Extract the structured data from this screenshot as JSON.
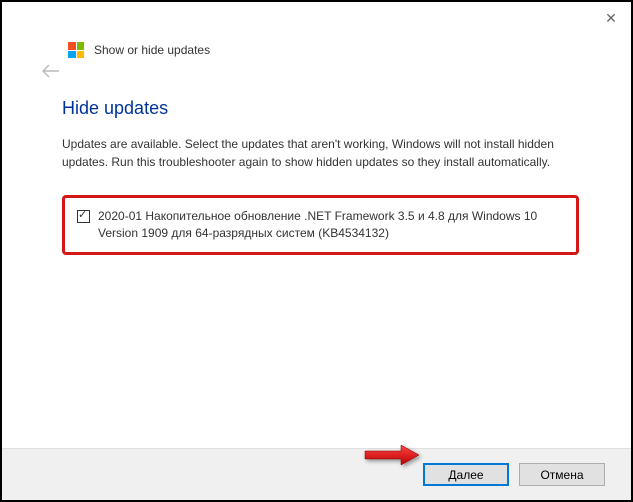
{
  "window": {
    "title": "Show or hide updates",
    "close_label": "✕"
  },
  "page": {
    "heading": "Hide updates",
    "description": "Updates are available. Select the updates that aren't working, Windows will not install hidden updates. Run this troubleshooter again to show hidden updates so they install automatically."
  },
  "updates": {
    "items": [
      {
        "label": "2020-01 Накопительное обновление .NET Framework 3.5 и 4.8 для Windows 10 Version 1909 для 64-разрядных систем (KB4534132)",
        "checked": true
      }
    ]
  },
  "buttons": {
    "next": "Далее",
    "cancel": "Отмена"
  }
}
